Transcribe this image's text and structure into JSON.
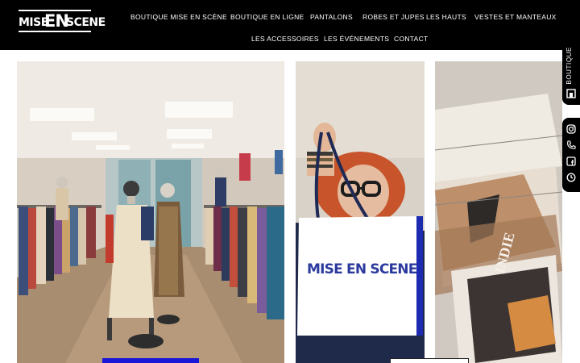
{
  "brand": {
    "logo_word1": "MISE",
    "logo_word2": "EN",
    "logo_word3": "SCENE"
  },
  "nav": {
    "row1": [
      "BOUTIQUE MISE EN SCÈNE",
      "BOUTIQUE EN LIGNE",
      "PANTALONS",
      "ROBES ET JUPES",
      "LES HAUTS",
      "VESTES ET MANTEAUX"
    ],
    "row2": [
      "LES ACCESSOIRES",
      "LES ÉVÉNEMENTS",
      "CONTACT"
    ]
  },
  "side_tab": {
    "label": "BOUTIQUE",
    "icons": [
      "shop-icon",
      "instagram-icon",
      "phone-icon",
      "facebook-icon",
      "clock-icon"
    ]
  },
  "shopping_bag": {
    "brand_text": "MISE EN SCENE"
  },
  "magazine": {
    "cover_text": "INDIE"
  },
  "colors": {
    "header_bg": "#000000",
    "accent_blue": "#1a17d8",
    "bag_text": "#2b3a9e"
  }
}
